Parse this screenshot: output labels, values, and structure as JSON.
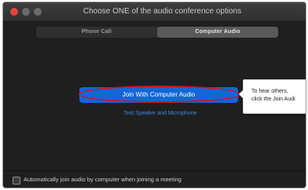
{
  "window": {
    "title": "Choose ONE of the audio conference options"
  },
  "tabs": [
    {
      "label": "Phone Call",
      "selected": false
    },
    {
      "label": "Computer Audio",
      "selected": true
    }
  ],
  "main": {
    "join_button_label": "Join With Computer Audio",
    "test_link_label": "Test Speaker and Microphone"
  },
  "tooltip": {
    "line1": "To hear others,",
    "line2": "click the Join Audi"
  },
  "footer": {
    "auto_join_label": "Automatically join audio by computer when joining a meeting",
    "auto_join_checked": false
  },
  "colors": {
    "primary_button": "#1466d6",
    "highlight_ring": "#d2141c",
    "link": "#3f86d8",
    "close_button": "#e0443e"
  }
}
